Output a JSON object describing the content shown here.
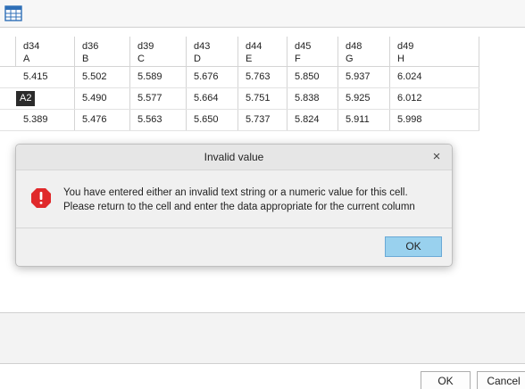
{
  "toolbar": {
    "icon": "table-icon"
  },
  "grid": {
    "columns": [
      {
        "name": "",
        "letter": ""
      },
      {
        "name": "d34",
        "letter": "A"
      },
      {
        "name": "d36",
        "letter": "B"
      },
      {
        "name": "d39",
        "letter": "C"
      },
      {
        "name": "d43",
        "letter": "D"
      },
      {
        "name": "d44",
        "letter": "E"
      },
      {
        "name": "d45",
        "letter": "F"
      },
      {
        "name": "d48",
        "letter": "G"
      },
      {
        "name": "d49",
        "letter": "H"
      }
    ],
    "rows": [
      [
        "",
        "5.415",
        "5.502",
        "5.589",
        "5.676",
        "5.763",
        "5.850",
        "5.937",
        "6.024"
      ],
      [
        "A2",
        "",
        "5.490",
        "5.577",
        "5.664",
        "5.751",
        "5.838",
        "5.925",
        "6.012"
      ],
      [
        "",
        "5.389",
        "5.476",
        "5.563",
        "5.650",
        "5.737",
        "5.824",
        "5.911",
        "5.998"
      ]
    ]
  },
  "dialog": {
    "title": "Invalid value",
    "close_glyph": "×",
    "icon": "error-icon",
    "message_line1": "You have entered either an invalid text string or a numeric value for this cell.",
    "message_line2": "Please return to the cell and enter the data appropriate for the current column",
    "ok_label": "OK",
    "ok_color": "#99d1ee"
  },
  "footer": {
    "ok_label": "OK",
    "cancel_label": "Cancel"
  },
  "colors": {
    "error_red": "#e0292b",
    "selection_badge": "#2b2b2b"
  }
}
